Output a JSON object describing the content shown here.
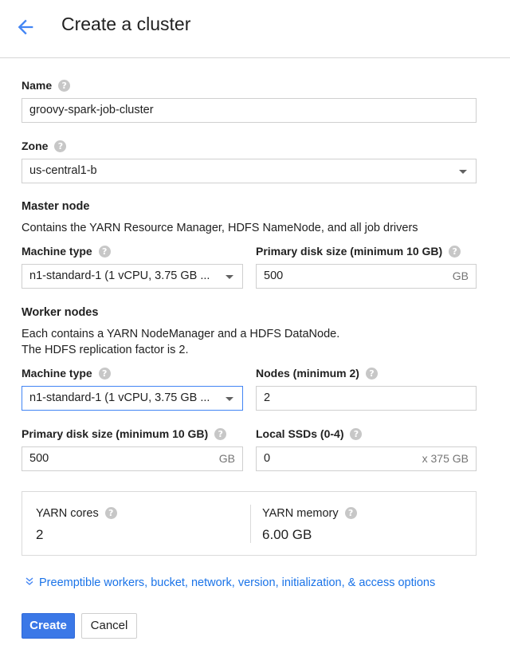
{
  "header": {
    "title": "Create a cluster",
    "back_icon": "arrow-left-icon"
  },
  "name": {
    "label": "Name",
    "value": "groovy-spark-job-cluster"
  },
  "zone": {
    "label": "Zone",
    "value": "us-central1-b"
  },
  "master": {
    "title": "Master node",
    "description": "Contains the YARN Resource Manager, HDFS NameNode, and all job drivers",
    "machine_type_label": "Machine type",
    "machine_type_value": "n1-standard-1 (1 vCPU, 3.75 GB ...",
    "disk_label": "Primary disk size (minimum 10 GB)",
    "disk_value": "500",
    "disk_unit": "GB"
  },
  "worker": {
    "title": "Worker nodes",
    "description_line1": "Each contains a YARN NodeManager and a HDFS DataNode.",
    "description_line2": "The HDFS replication factor is 2.",
    "machine_type_label": "Machine type",
    "machine_type_value": "n1-standard-1 (1 vCPU, 3.75 GB ...",
    "nodes_label": "Nodes (minimum 2)",
    "nodes_value": "2",
    "disk_label": "Primary disk size (minimum 10 GB)",
    "disk_value": "500",
    "disk_unit": "GB",
    "ssd_label": "Local SSDs (0-4)",
    "ssd_value": "0",
    "ssd_unit": "x 375 GB"
  },
  "stats": {
    "cores_label": "YARN cores",
    "cores_value": "2",
    "memory_label": "YARN memory",
    "memory_value": "6.00 GB"
  },
  "more_options": "Preemptible workers, bucket, network, version, initialization, & access options",
  "buttons": {
    "create": "Create",
    "cancel": "Cancel"
  },
  "colors": {
    "accent": "#3b78e7",
    "link": "#1a73e8",
    "focus_border": "#4285f4"
  }
}
